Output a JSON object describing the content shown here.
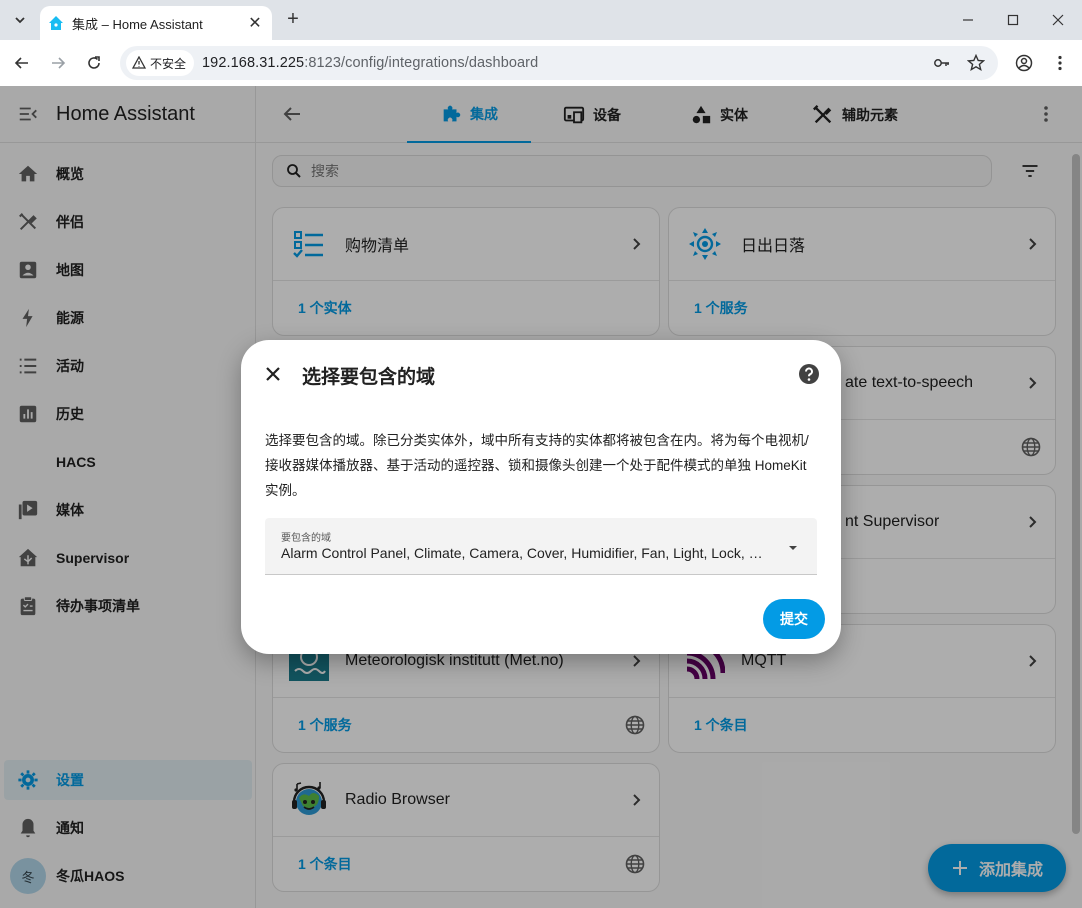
{
  "browser": {
    "tab_title": "集成 – Home Assistant",
    "new_tab": "+",
    "security_label": "不安全",
    "url_host": "192.168.31.225",
    "url_rest": ":8123/config/integrations/dashboard"
  },
  "sidebar": {
    "title": "Home Assistant",
    "items": [
      {
        "label": "概览",
        "icon": "home-icon"
      },
      {
        "label": "伴侣",
        "icon": "tools-icon"
      },
      {
        "label": "地图",
        "icon": "map-icon"
      },
      {
        "label": "能源",
        "icon": "lightning-icon"
      },
      {
        "label": "活动",
        "icon": "list-icon"
      },
      {
        "label": "历史",
        "icon": "chart-icon"
      },
      {
        "label": "HACS",
        "icon": ""
      },
      {
        "label": "媒体",
        "icon": "media-icon"
      },
      {
        "label": "Supervisor",
        "icon": "supervisor-icon"
      },
      {
        "label": "待办事项清单",
        "icon": "clipboard-icon"
      }
    ],
    "settings": "设置",
    "notifications": "通知",
    "user": {
      "name": "冬瓜HAOS",
      "initial": "冬"
    }
  },
  "topbar": {
    "tabs": [
      {
        "label": "集成",
        "active": true
      },
      {
        "label": "设备",
        "active": false
      },
      {
        "label": "实体",
        "active": false
      },
      {
        "label": "辅助元素",
        "active": false
      }
    ]
  },
  "search": {
    "placeholder": "搜索"
  },
  "cards": [
    {
      "title": "购物清单",
      "link": "1 个实体",
      "globe": false
    },
    {
      "title": "日出日落",
      "link": "1 个服务",
      "globe": false
    },
    {
      "title": "ate text-to-speech",
      "link": "",
      "globe": true
    },
    {
      "title": "nt Supervisor",
      "link": "",
      "globe": false
    },
    {
      "title": "Meteorologisk institutt (Met.no)",
      "link": "1 个服务",
      "globe": true
    },
    {
      "title": "MQTT",
      "link": "1 个条目",
      "globe": false
    },
    {
      "title": "Radio Browser",
      "link": "1 个条目",
      "globe": true
    }
  ],
  "fab": {
    "label": "添加集成"
  },
  "dialog": {
    "title": "选择要包含的域",
    "description": "选择要包含的域。除已分类实体外，域中所有支持的实体都将被包含在内。将为每个电视机/接收器媒体播放器、基于活动的遥控器、锁和摄像头创建一个处于配件模式的单独 HomeKit 实例。",
    "select_label": "要包含的域",
    "select_value": "Alarm Control Panel, Climate, Camera, Cover, Humidifier, Fan, Light, Lock, Me...",
    "submit": "提交"
  },
  "colors": {
    "accent": "#039be5",
    "mqtt": "#660066",
    "met": "#1b7c8c"
  }
}
